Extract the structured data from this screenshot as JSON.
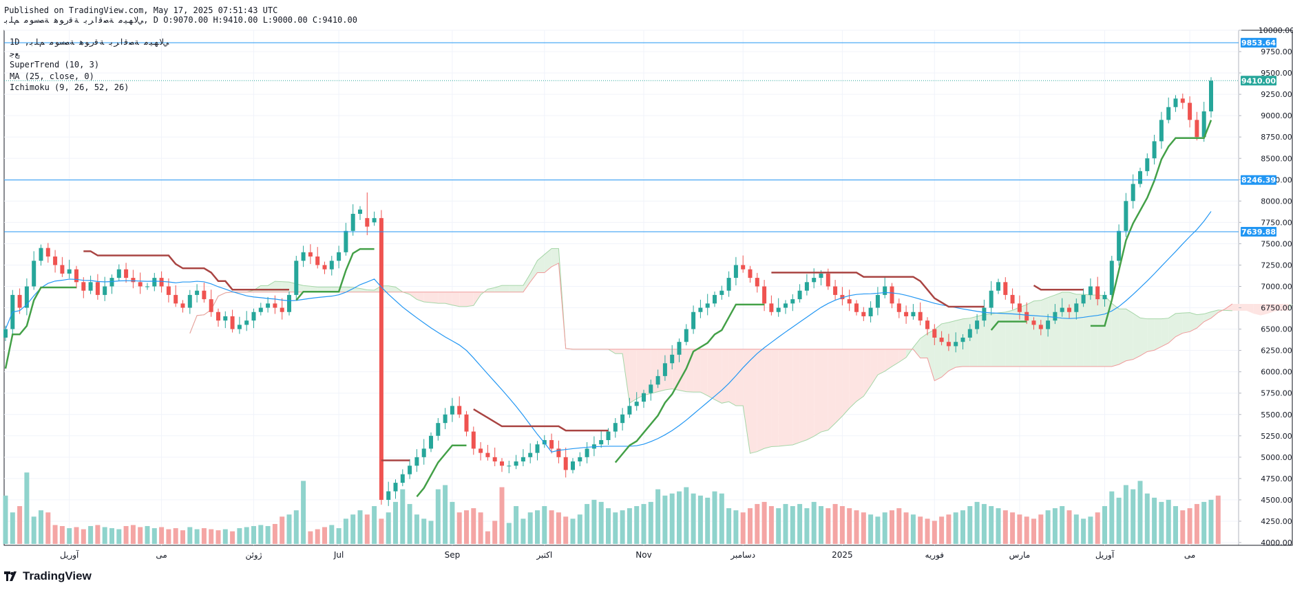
{
  "header": {
    "published": "Published on TradingView.com, May 17, 2025 07:51:43 UTC",
    "symbol_line": "ﻲﻟﺎﻬﻴﻣ ﺔﺼﻗاﺮﺑ ﺔﻗرﻮﻫ ﺔﺼﺳﻮﻣ ﻢﻠﺑ, D O:9070.00 H:9410.00 L:9000.00 C:9410.00"
  },
  "legend": {
    "symbol": "1D ,ﻲﻟﺎﻬﻴﻣ ﺔﺼﻗاﺮﺑ ﺔﻗرﻮﻫ ﺔﺼﺳﻮﻣ ﻢﻠﺑ",
    "currency": "ﻊﺟ",
    "supertrend": "SuperTrend (10, 3)",
    "ma": "MA (25, close, 0)",
    "ichimoku": "Ichimoku (9, 26, 52, 26)"
  },
  "branding": {
    "logo_icon": "tradingview-logo-icon",
    "name": "TradingView"
  },
  "colors": {
    "up": "#26a69a",
    "down": "#ef5350",
    "vol_up": "#8fd3cc",
    "vol_down": "#f4a5a4",
    "supertrend_up": "#43a047",
    "supertrend_down": "#a94442",
    "ma": "#2196f3",
    "hline": "#2196f3",
    "cloud_green": "#e3f2e3",
    "cloud_red": "#fde4e2"
  },
  "chart_data": {
    "type": "candlestick",
    "ylim": [
      4000,
      10000
    ],
    "y_ticks": [
      "10000.00",
      "9750.00",
      "9500.00",
      "9250.00",
      "9000.00",
      "8750.00",
      "8500.00",
      "8250.00",
      "8000.00",
      "7750.00",
      "7500.00",
      "7250.00",
      "7000.00",
      "6750.00",
      "6500.00",
      "6250.00",
      "6000.00",
      "5750.00",
      "5500.00",
      "5250.00",
      "5000.00",
      "4750.00",
      "4500.00",
      "4250.00",
      "4000.00"
    ],
    "x_labels": [
      {
        "label": "آوریل",
        "i": 9
      },
      {
        "label": "می",
        "i": 22
      },
      {
        "label": "ژوئن",
        "i": 35
      },
      {
        "label": "Jul",
        "i": 47
      },
      {
        "label": "Sep",
        "i": 63
      },
      {
        "label": "اکتبر",
        "i": 76
      },
      {
        "label": "Nov",
        "i": 90
      },
      {
        "label": "دسامبر",
        "i": 104
      },
      {
        "label": "2025",
        "i": 118
      },
      {
        "label": "فوریه",
        "i": 131
      },
      {
        "label": "مارس",
        "i": 143
      },
      {
        "label": "آوریل",
        "i": 155
      },
      {
        "label": "می",
        "i": 167
      }
    ],
    "price_tags": [
      {
        "label": "9853.64",
        "value": 9853.64,
        "color": "#2196f3",
        "line": "solid"
      },
      {
        "label": "9410.00",
        "value": 9410.0,
        "color": "#26a69a",
        "line": "dotted"
      },
      {
        "label": "8246.39",
        "value": 8246.39,
        "color": "#2196f3",
        "line": "solid"
      },
      {
        "label": "7639.88",
        "value": 7639.88,
        "color": "#2196f3",
        "line": "solid"
      }
    ],
    "close": [
      6500,
      6900,
      6750,
      7000,
      7300,
      7450,
      7350,
      7250,
      7150,
      7200,
      7050,
      6950,
      7050,
      6900,
      7000,
      7100,
      7200,
      7100,
      7050,
      7000,
      7000,
      7100,
      7000,
      6900,
      6800,
      6750,
      6900,
      6950,
      6850,
      6700,
      6600,
      6650,
      6500,
      6550,
      6600,
      6700,
      6750,
      6800,
      6750,
      6700,
      6900,
      7300,
      7400,
      7350,
      7250,
      7200,
      7300,
      7400,
      7650,
      7850,
      7900,
      null,
      null,
      4500,
      4600,
      4700,
      4800,
      4900,
      5000,
      5100,
      5250,
      5400,
      5500,
      5600,
      5500,
      5300,
      5100,
      5050,
      5000,
      4950,
      4900,
      4900,
      4950,
      5000,
      5050,
      5150,
      5200,
      5100,
      5000,
      4850,
      4950,
      5000,
      5100,
      5150,
      5200,
      5300,
      5400,
      5500,
      5600,
      5650,
      5750,
      5850,
      5950,
      6100,
      6200,
      6350,
      6500,
      6700,
      6750,
      6800,
      6900,
      6950,
      7100,
      7250,
      7200,
      7100,
      7000,
      6800,
      6700,
      6750,
      6800,
      6850,
      6950,
      7050,
      7100,
      7150,
      7000,
      6900,
      6850,
      6800,
      6700,
      6650,
      6750,
      6900,
      7000,
      6800,
      6700,
      6650,
      6700,
      6600,
      6500,
      6400,
      6350,
      6300,
      6350,
      6400,
      6500,
      6600,
      6750,
      6950,
      7050,
      6900,
      6800,
      6700,
      6600,
      6550,
      6500,
      6600,
      6700,
      6750,
      6700,
      6800,
      6900,
      7000,
      6850,
      6900,
      7300,
      7650,
      8000,
      8200,
      8350,
      8500,
      8700,
      8950,
      9100,
      9200,
      9150,
      8950,
      8750,
      9050,
      9410
    ],
    "volume": [
      230,
      150,
      180,
      340,
      130,
      160,
      150,
      90,
      85,
      75,
      80,
      70,
      85,
      90,
      80,
      75,
      70,
      85,
      90,
      80,
      85,
      75,
      80,
      70,
      75,
      65,
      80,
      70,
      75,
      70,
      65,
      70,
      60,
      75,
      80,
      85,
      90,
      85,
      95,
      130,
      140,
      160,
      300,
      60,
      70,
      80,
      90,
      75,
      120,
      140,
      160,
      140,
      180,
      120,
      150,
      200,
      260,
      190,
      140,
      120,
      110,
      260,
      280,
      200,
      150,
      160,
      170,
      150,
      60,
      110,
      270,
      100,
      180,
      120,
      150,
      160,
      180,
      160,
      150,
      130,
      120,
      140,
      190,
      210,
      200,
      170,
      150,
      160,
      170,
      180,
      190,
      200,
      260,
      230,
      240,
      250,
      270,
      240,
      230,
      220,
      250,
      240,
      170,
      160,
      150,
      170,
      190,
      200,
      180,
      170,
      190,
      180,
      190,
      170,
      200,
      180,
      170,
      190,
      180,
      170,
      160,
      150,
      140,
      130,
      150,
      160,
      170,
      150,
      140,
      130,
      120,
      110,
      130,
      140,
      150,
      160,
      180,
      200,
      190,
      180,
      170,
      160,
      150,
      140,
      130,
      120,
      140,
      160,
      170,
      180,
      160,
      140,
      120,
      130,
      150,
      180,
      250,
      220,
      280,
      260,
      300,
      240,
      220,
      200,
      210,
      180,
      160,
      170,
      190,
      200,
      210,
      230
    ]
  }
}
